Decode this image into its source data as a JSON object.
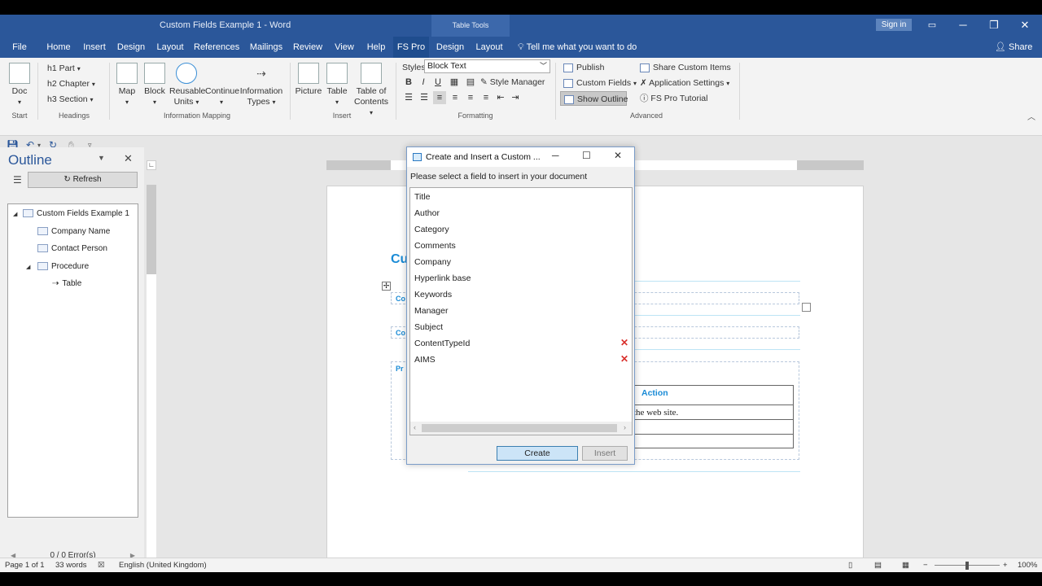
{
  "window": {
    "title": "Custom Fields Example 1  -  Word",
    "context_tab": "Table Tools",
    "sign_in": "Sign in",
    "minimize": "─",
    "restore": "❐",
    "close": "✕"
  },
  "menu": {
    "tabs": [
      "File",
      "Home",
      "Insert",
      "Design",
      "Layout",
      "References",
      "Mailings",
      "Review",
      "View",
      "Help",
      "FS Pro",
      "Design",
      "Layout"
    ],
    "tell_me": "Tell me what you want to do",
    "share": "Share"
  },
  "ribbon": {
    "start": {
      "doc": "Doc",
      "label": "Start"
    },
    "headings": {
      "part": "h1  Part",
      "chapter": "h2  Chapter",
      "section": "h3  Section",
      "label": "Headings"
    },
    "information_mapping": {
      "map": "Map",
      "block": "Block",
      "reusable_units": "Reusable Units",
      "continue": "Continue",
      "information_types": "Information Types",
      "label": "Information Mapping"
    },
    "insert": {
      "picture": "Picture",
      "table": "Table",
      "toc": "Table of Contents",
      "label": "Insert"
    },
    "formatting": {
      "styles_label": "Styles",
      "style_value": "Block Text",
      "style_manager": "Style Manager",
      "label": "Formatting",
      "bold": "B",
      "italic": "I",
      "underline": "U"
    },
    "advanced": {
      "publish": "Publish",
      "custom_fields": "Custom Fields",
      "show_outline": "Show Outline",
      "share_custom_items": "Share Custom Items",
      "application_settings": "Application Settings",
      "fs_pro_tutorial": "FS Pro Tutorial",
      "label": "Advanced"
    }
  },
  "outline": {
    "title": "Outline",
    "refresh": "Refresh",
    "tree": [
      {
        "label": "Custom Fields Example 1",
        "level": 0,
        "expanded": true
      },
      {
        "label": "Company Name",
        "level": 1
      },
      {
        "label": "Contact Person",
        "level": 1
      },
      {
        "label": "Procedure",
        "level": 1,
        "expanded": true
      },
      {
        "label": "Table",
        "level": 2
      }
    ],
    "errors": "0 / 0  Error(s)"
  },
  "document": {
    "heading": "Cu",
    "field_labels": [
      "Co",
      "Co",
      "Pr"
    ],
    "table_header": "Action",
    "table_cell": "the web site."
  },
  "dialog": {
    "title": "Create and Insert a Custom ...",
    "prompt": "Please select a field to insert in your document",
    "fields": [
      {
        "name": "Title",
        "deletable": false
      },
      {
        "name": "Author",
        "deletable": false
      },
      {
        "name": "Category",
        "deletable": false
      },
      {
        "name": "Comments",
        "deletable": false
      },
      {
        "name": "Company",
        "deletable": false
      },
      {
        "name": "Hyperlink base",
        "deletable": false
      },
      {
        "name": "Keywords",
        "deletable": false
      },
      {
        "name": "Manager",
        "deletable": false
      },
      {
        "name": "Subject",
        "deletable": false
      },
      {
        "name": "ContentTypeId",
        "deletable": true
      },
      {
        "name": "AIMS",
        "deletable": true
      }
    ],
    "create": "Create",
    "insert": "Insert"
  },
  "status": {
    "page": "Page 1 of 1",
    "words": "33 words",
    "language": "English (United Kingdom)",
    "zoom": "100%"
  },
  "colors": {
    "word_blue": "#2b579a",
    "heading_blue": "#1a8bd6",
    "delete_red": "#d9302c"
  }
}
